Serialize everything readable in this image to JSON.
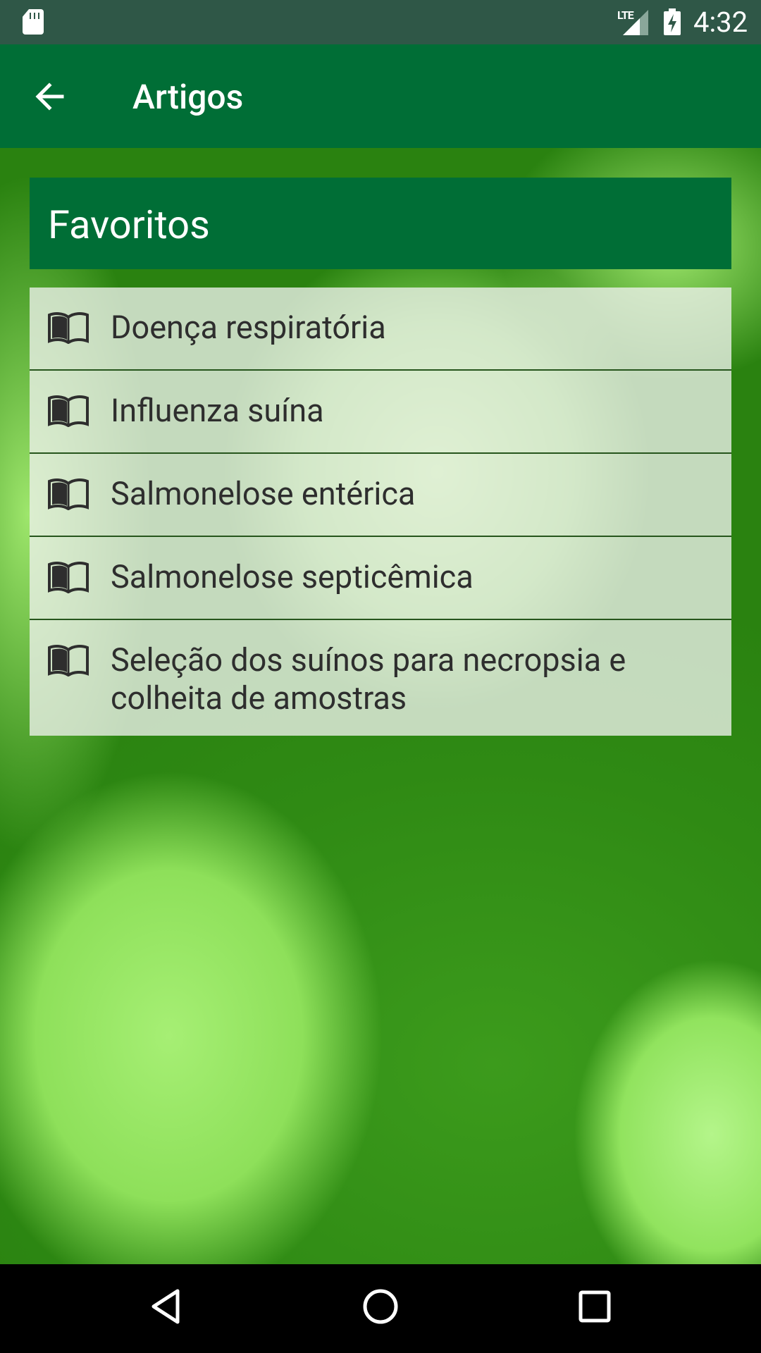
{
  "status_bar": {
    "time": "4:32",
    "network_label": "LTE",
    "icons": [
      "sd-card-icon",
      "signal-icon",
      "battery-charging-icon"
    ]
  },
  "app_bar": {
    "title": "Artigos",
    "back_icon": "arrow-left-icon"
  },
  "favorites": {
    "header": "Favoritos",
    "items": [
      {
        "label": "Doença respiratória",
        "icon": "book-icon"
      },
      {
        "label": "Influenza suína",
        "icon": "book-icon"
      },
      {
        "label": "Salmonelose entérica",
        "icon": "book-icon"
      },
      {
        "label": "Salmonelose septicêmica",
        "icon": "book-icon"
      },
      {
        "label": "Seleção dos suínos para necropsia e colheita de amostras",
        "icon": "book-icon"
      }
    ]
  },
  "nav_bar": {
    "icons": [
      "back-triangle-icon",
      "home-circle-icon",
      "recents-square-icon"
    ]
  },
  "colors": {
    "status_bar": "#2f5747",
    "app_bar": "#006e36",
    "list_item_bg": "#ebf0e8",
    "text_dark": "#2e2e2e"
  }
}
